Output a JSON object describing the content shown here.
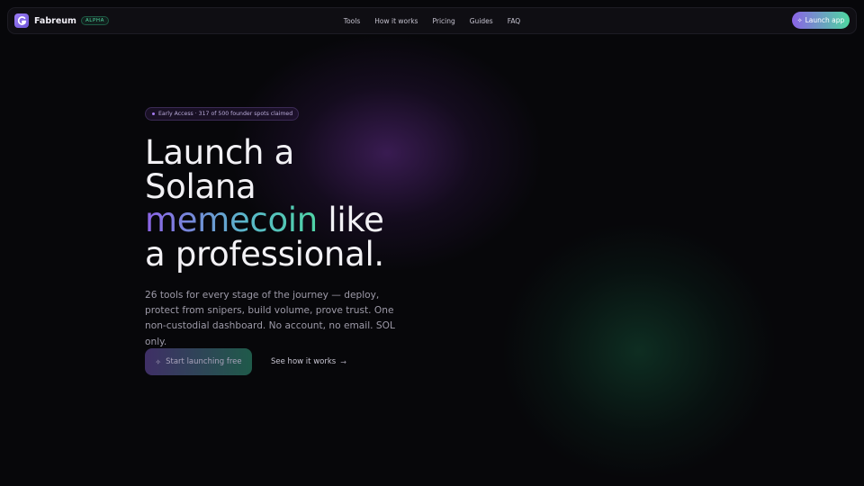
{
  "brand": {
    "name": "Fabreum",
    "badge": "ALPHA"
  },
  "nav": {
    "links": [
      "Tools",
      "How it works",
      "Pricing",
      "Guides",
      "FAQ"
    ],
    "launch_button": "Launch app"
  },
  "hero": {
    "pill_text": "Early Access · 317 of 500 founder spots claimed",
    "headline": {
      "line1": "Launch a",
      "line2": "Solana",
      "highlight": "memecoin",
      "line3_rest": " like",
      "line4": "a professional."
    },
    "subtitle": "26 tools for every stage of the journey — deploy, protect from snipers, build volume, prove trust. One non-custodial dashboard. No account, no email. SOL only.",
    "primary_cta": "Start launching free",
    "secondary_cta": "See how it works"
  },
  "colors": {
    "accent_purple": "#8d63e8",
    "accent_green": "#4fd4a6",
    "background": "#07070a"
  },
  "icons": {
    "logo": "fabreum-logo-icon",
    "launch": "sparkle-icon",
    "primary_cta": "sparkle-icon",
    "secondary_cta": "arrow-right-icon"
  }
}
